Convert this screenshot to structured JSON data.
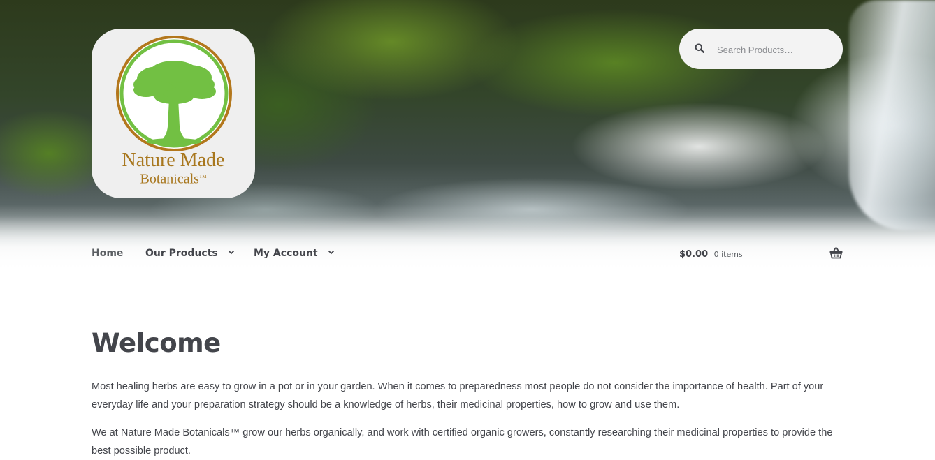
{
  "header": {
    "logo": {
      "line1": "Nature Made",
      "line2": "Botanicals",
      "trademark": "TM",
      "icon": "tree-icon",
      "colors": {
        "ring": "#b3771c",
        "tree": "#72c043",
        "text": "#a8771e"
      }
    },
    "search": {
      "placeholder": "Search Products…",
      "value": "",
      "icon": "search-icon"
    }
  },
  "nav": {
    "items": [
      {
        "label": "Home",
        "has_dropdown": false
      },
      {
        "label": "Our Products",
        "has_dropdown": true
      },
      {
        "label": "My Account",
        "has_dropdown": true
      }
    ],
    "cart": {
      "amount": "$0.00",
      "count": "0 items",
      "icon": "basket-icon"
    }
  },
  "main": {
    "title": "Welcome",
    "paragraphs": [
      "Most healing herbs are easy to grow in a pot or in your garden. When it comes to preparedness most people do not consider the importance of health. Part of your everyday life and your preparation strategy should be a knowledge of herbs, their medicinal properties, how to grow and use them.",
      "We at Nature Made Botanicals™ grow our herbs organically, and work with certified organic growers, constantly researching their medicinal properties to provide the best possible product."
    ]
  },
  "colors": {
    "text": "#43454b",
    "search_bg": "#f3f3f3"
  }
}
